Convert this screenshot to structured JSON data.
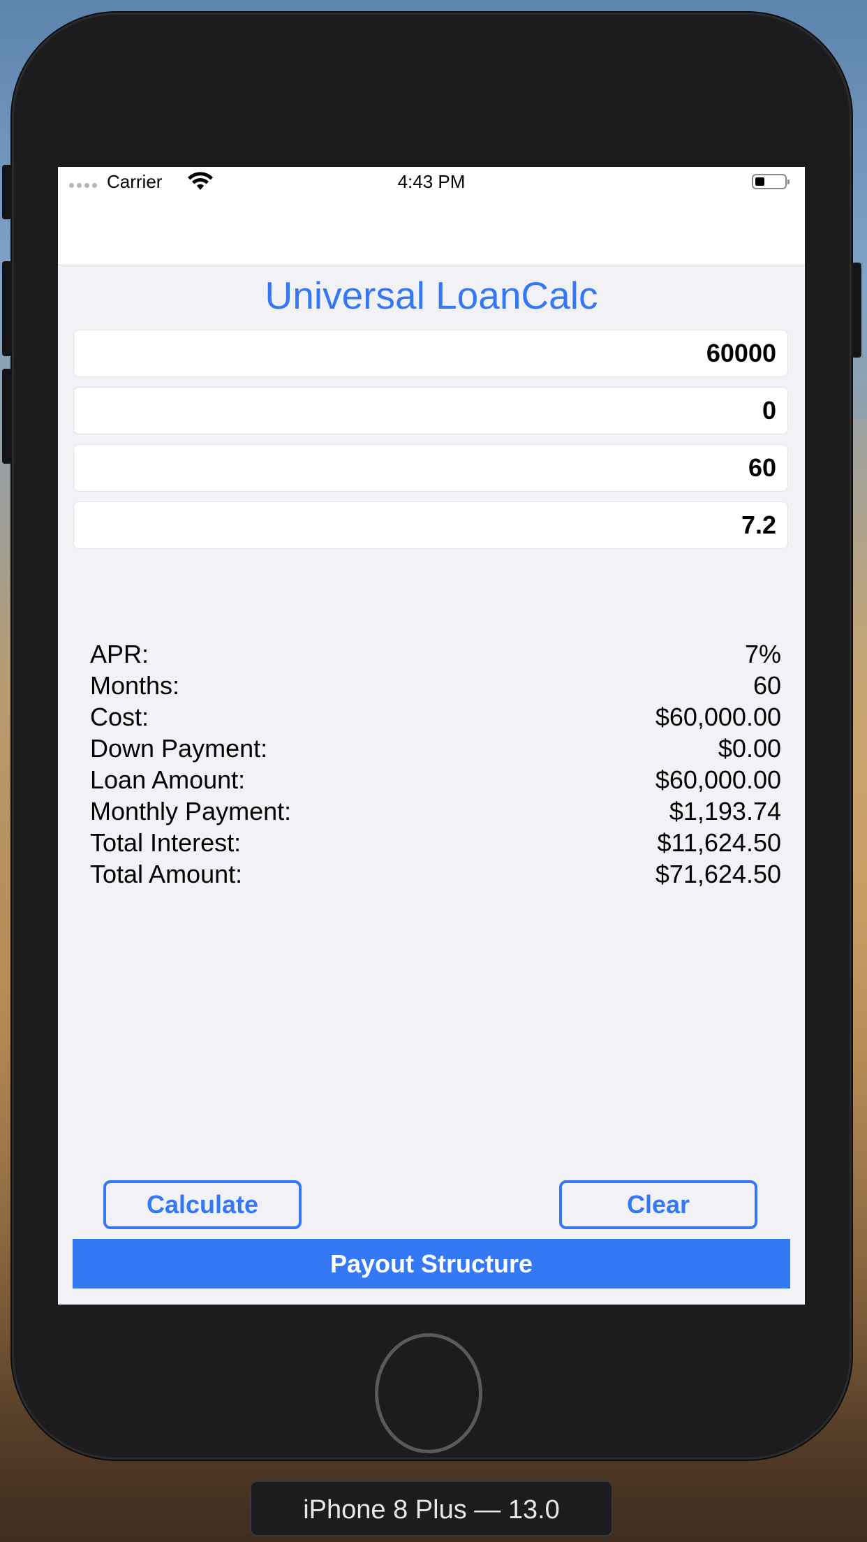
{
  "status_bar": {
    "carrier": "Carrier",
    "time": "4:43 PM"
  },
  "app": {
    "title": "Universal LoanCalc"
  },
  "inputs": [
    {
      "value": "60000"
    },
    {
      "value": "0"
    },
    {
      "value": "60"
    },
    {
      "value": "7.2"
    }
  ],
  "results": [
    {
      "label": "APR:",
      "value": "7%"
    },
    {
      "label": "Months:",
      "value": "60"
    },
    {
      "label": "Cost:",
      "value": "$60,000.00"
    },
    {
      "label": "Down Payment:",
      "value": "$0.00"
    },
    {
      "label": "Loan Amount:",
      "value": "$60,000.00"
    },
    {
      "label": "Monthly Payment:",
      "value": "$1,193.74"
    },
    {
      "label": "Total Interest:",
      "value": "$11,624.50"
    },
    {
      "label": "Total Amount:",
      "value": "$71,624.50"
    }
  ],
  "buttons": {
    "calculate": "Calculate",
    "clear": "Clear",
    "payout": "Payout Structure"
  },
  "simulator": {
    "device_label": "iPhone 8 Plus — 13.0"
  },
  "colors": {
    "accent": "#3478f6",
    "screen_background": "#f1f1f6"
  }
}
